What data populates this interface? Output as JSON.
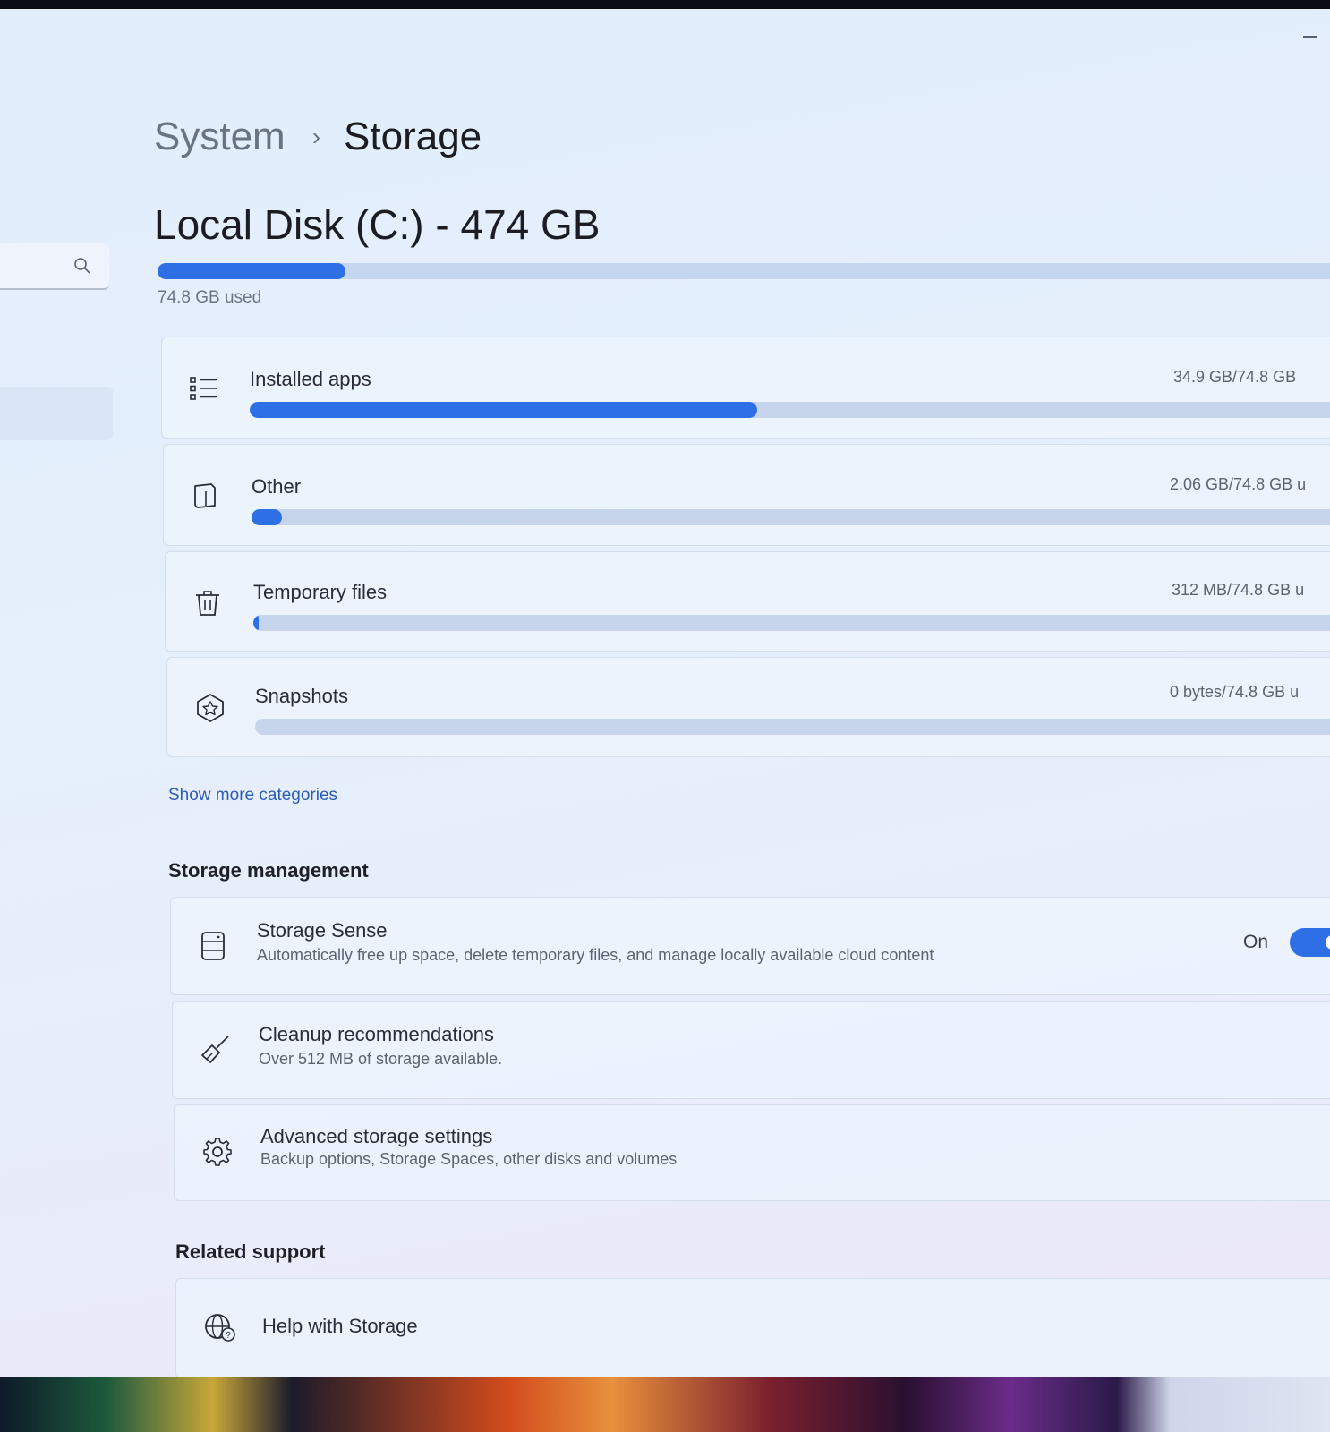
{
  "breadcrumb": {
    "parent": "System",
    "separator": "›",
    "current": "Storage"
  },
  "disk": {
    "title": "Local Disk (C:) - 474 GB",
    "used_label": "74.8 GB used",
    "used_fraction": 0.158
  },
  "categories": [
    {
      "label": "Installed apps",
      "value": "34.9 GB/74.8 GB",
      "fraction": 0.466,
      "icon": "list-icon"
    },
    {
      "label": "Other",
      "value": "2.06 GB/74.8 GB u",
      "fraction": 0.028,
      "icon": "document-icon"
    },
    {
      "label": "Temporary files",
      "value": "312 MB/74.8 GB u",
      "fraction": 0.004,
      "icon": "trash-icon"
    },
    {
      "label": "Snapshots",
      "value": "0 bytes/74.8 GB u",
      "fraction": 0.0,
      "icon": "snapshot-icon"
    }
  ],
  "show_more": "Show more categories",
  "storage_management": {
    "title": "Storage management",
    "items": [
      {
        "title": "Storage Sense",
        "desc": "Automatically free up space, delete temporary files, and manage locally available cloud content",
        "status": "On",
        "icon": "drive-icon"
      },
      {
        "title": "Cleanup recommendations",
        "desc": "Over 512 MB of storage available.",
        "icon": "broom-icon"
      },
      {
        "title": "Advanced storage settings",
        "desc": "Backup options, Storage Spaces, other disks and volumes",
        "icon": "gear-icon"
      }
    ]
  },
  "related_support": {
    "title": "Related support",
    "items": [
      {
        "title": "Help with Storage",
        "icon": "globe-help-icon"
      }
    ]
  },
  "colors": {
    "accent": "#2f6fe6",
    "track": "#c6d4ec",
    "background": "#e4eefc"
  }
}
